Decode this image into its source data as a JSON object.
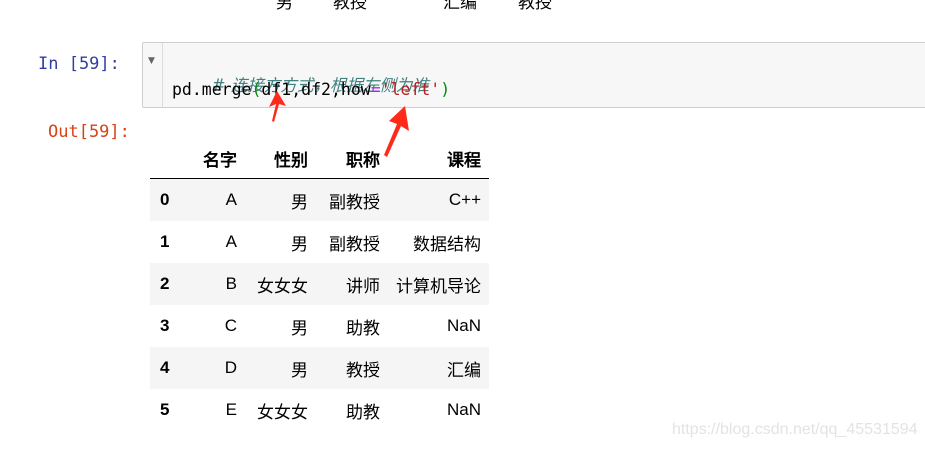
{
  "previous_output_row": [
    "男",
    "教授",
    "汇编",
    "教授"
  ],
  "cell": {
    "input_prompt": "In  [59]:",
    "output_prompt": "Out[59]:",
    "code": {
      "comment": "# 连接方方式，根据左侧为准",
      "call_prefix": "pd.merge",
      "open_paren": "(",
      "args_left": "df1,df2,how",
      "equals": "=",
      "string_arg": "'left'",
      "close_paren": ")"
    },
    "fold_icon": "triangle-down-icon"
  },
  "dataframe": {
    "columns": [
      "名字",
      "性别",
      "职称",
      "课程"
    ],
    "rows": [
      {
        "index": "0",
        "values": [
          "A",
          "男",
          "副教授",
          "C++"
        ]
      },
      {
        "index": "1",
        "values": [
          "A",
          "男",
          "副教授",
          "数据结构"
        ]
      },
      {
        "index": "2",
        "values": [
          "B",
          "女女女",
          "讲师",
          "计算机导论"
        ]
      },
      {
        "index": "3",
        "values": [
          "C",
          "男",
          "助教",
          "NaN"
        ]
      },
      {
        "index": "4",
        "values": [
          "D",
          "男",
          "教授",
          "汇编"
        ]
      },
      {
        "index": "5",
        "values": [
          "E",
          "女女女",
          "助教",
          "NaN"
        ]
      }
    ]
  },
  "annotations": {
    "arrow_color": "#ff2a1a"
  },
  "watermark": "https://blog.csdn.net/qq_45531594"
}
